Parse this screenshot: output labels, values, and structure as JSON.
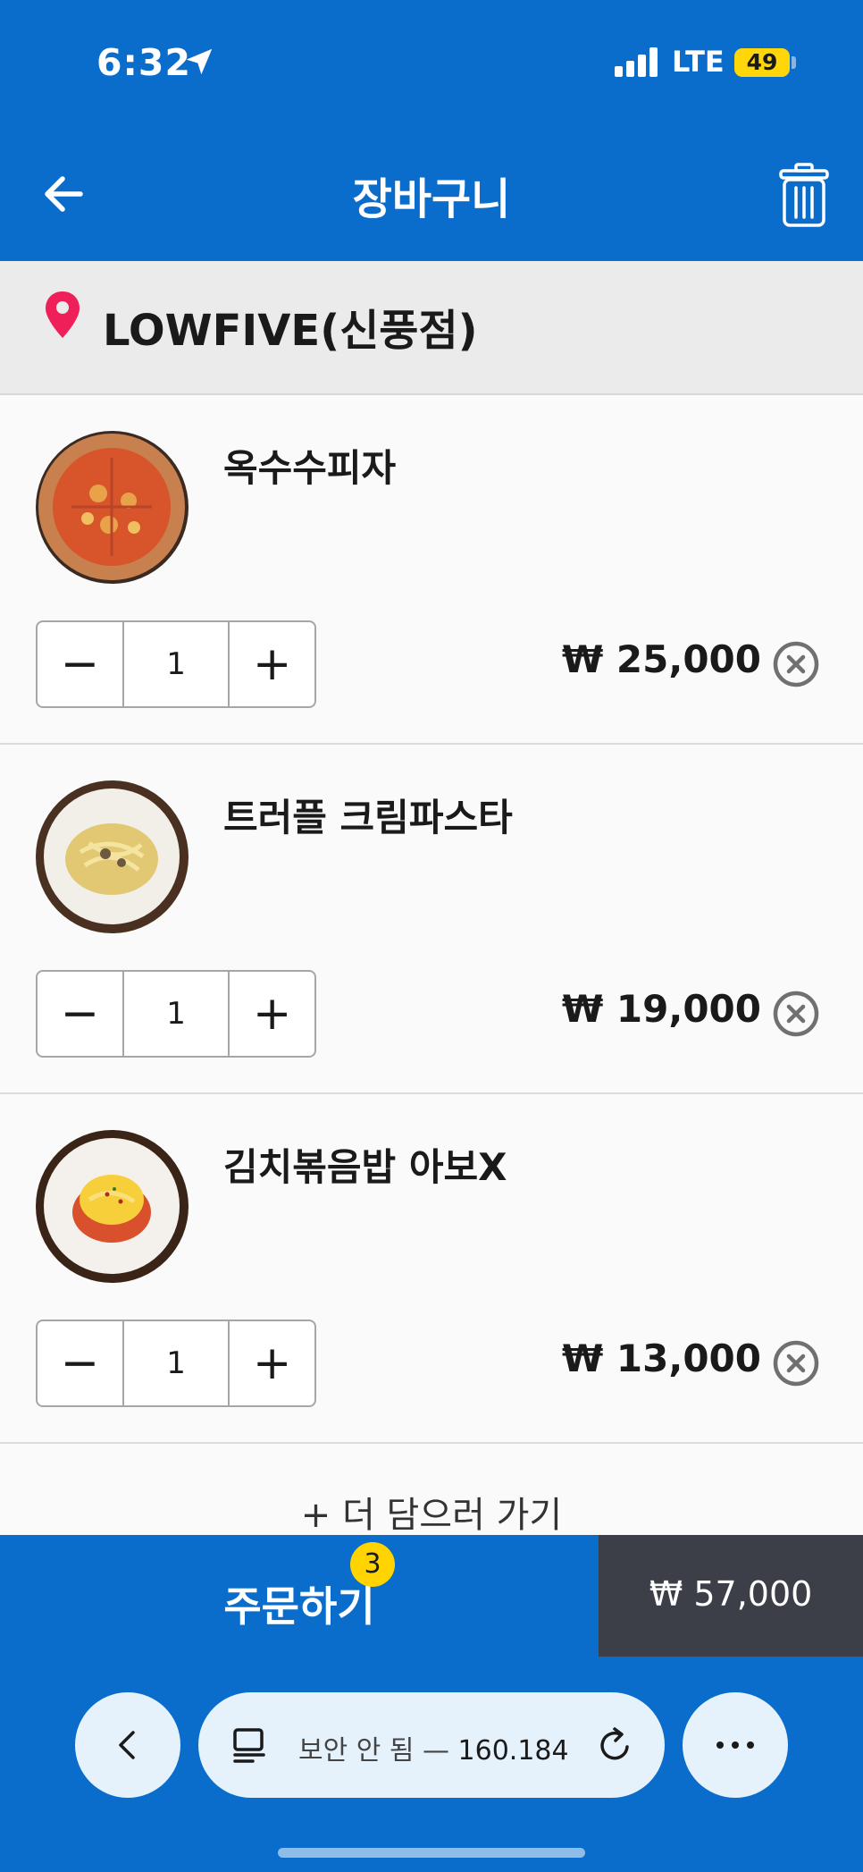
{
  "status_bar": {
    "time": "6:32",
    "network": "LTE",
    "battery": "49"
  },
  "header": {
    "title": "장바구니",
    "back_icon": "arrow-left-icon",
    "trash_icon": "trash-icon"
  },
  "store": {
    "name": "LOWFIVE(신풍점)",
    "icon": "location-pin-icon",
    "pin_color": "#ef1f5a"
  },
  "cart": {
    "items": [
      {
        "name": "옥수수피자",
        "quantity": "1",
        "price": "₩ 25,000",
        "image": "corn-pizza-image"
      },
      {
        "name": "트러플 크림파스타",
        "quantity": "1",
        "price": "₩ 19,000",
        "image": "truffle-pasta-image"
      },
      {
        "name": "김치볶음밥 아보X",
        "quantity": "1",
        "price": "₩ 13,000",
        "image": "kimchi-fried-rice-image"
      }
    ],
    "minus_label": "−",
    "plus_label": "+",
    "add_more": "+ 더 담으러 가기"
  },
  "order": {
    "label": "주문하기",
    "count": "3",
    "total": "₩ 57,000"
  },
  "browser": {
    "url_prefix": "보안 안 됨 — ",
    "url_host": "160.184"
  },
  "colors": {
    "primary": "#0a6dcc",
    "badge": "#ffd400",
    "total_bg": "#3c3f48"
  }
}
